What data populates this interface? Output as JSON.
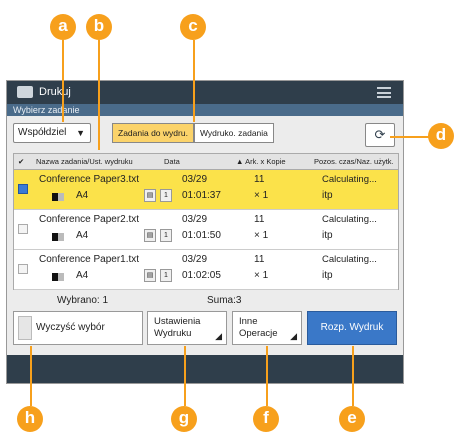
{
  "window": {
    "title": "Drukuj",
    "subtitle": "Wybierz zadanie"
  },
  "filter": {
    "label": "Współdziel"
  },
  "tabs": [
    {
      "label": "Zadania do wydru."
    },
    {
      "label": "Wydruko. zadania"
    }
  ],
  "table": {
    "columns": [
      "Nazwa zadania/Ust. wydruku",
      "Data",
      "▲ Ark. x Kopie",
      "Pozos. czas/Naz. użytk."
    ],
    "rows": [
      {
        "name": "Conference Paper3.txt",
        "size": "A4",
        "date": "03/29",
        "time": "01:01:37",
        "copies": "11",
        "mult": "× 1",
        "status": "Calculating...",
        "user": "itp",
        "selected": true
      },
      {
        "name": "Conference Paper2.txt",
        "size": "A4",
        "date": "03/29",
        "time": "01:01:50",
        "copies": "11",
        "mult": "× 1",
        "status": "Calculating...",
        "user": "itp",
        "selected": false
      },
      {
        "name": "Conference Paper1.txt",
        "size": "A4",
        "date": "03/29",
        "time": "01:02:05",
        "copies": "11",
        "mult": "× 1",
        "status": "Calculating...",
        "user": "itp",
        "selected": false
      }
    ]
  },
  "footer": {
    "selected": "Wybrano: 1",
    "sum": "Suma:3",
    "clear_label": "Wyczyść wybór",
    "settings_line1": "Ustawienia",
    "settings_line2": "Wydruku",
    "ops_line1": "Inne",
    "ops_line2": "Operacje",
    "start_label": "Rozp. Wydruk"
  },
  "callouts": [
    "a",
    "b",
    "c",
    "d",
    "e",
    "f",
    "g",
    "h"
  ],
  "colors": {
    "callout": "#f7a01c",
    "titlebar": "#2f3e4b",
    "selected_row": "#fbe24a",
    "primary_button": "#3a78c8"
  }
}
